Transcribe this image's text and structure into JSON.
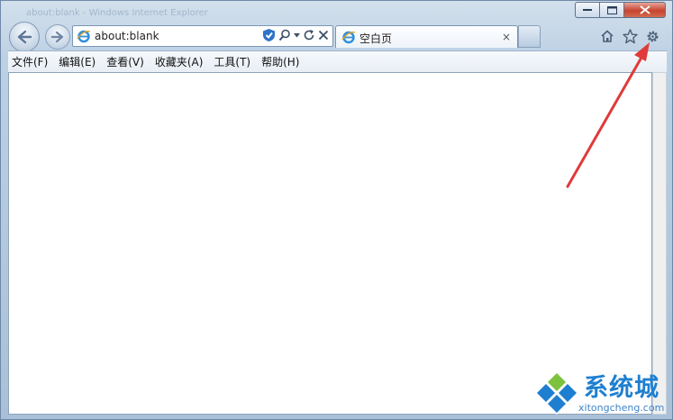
{
  "window": {
    "title_faint": "about:blank - Windows Internet Explorer",
    "minimize_glyph": "—",
    "maximize_glyph": "□",
    "close_glyph": "✕"
  },
  "address_bar": {
    "url": "about:blank",
    "icons": [
      "ie-icon",
      "shield-icon",
      "search-icon",
      "dropdown-icon",
      "refresh-icon",
      "stop-icon"
    ]
  },
  "tab": {
    "label": "空白页",
    "close_glyph": "×"
  },
  "toolbar_icons": [
    "home-icon",
    "star-icon",
    "gear-icon"
  ],
  "menu": {
    "items": [
      {
        "label": "文件(F)"
      },
      {
        "label": "编辑(E)"
      },
      {
        "label": "查看(V)"
      },
      {
        "label": "收藏夹(A)"
      },
      {
        "label": "工具(T)"
      },
      {
        "label": "帮助(H)"
      }
    ]
  },
  "watermark": {
    "brand": "系统城",
    "site": "xitongcheng.com"
  },
  "colors": {
    "annotation_arrow": "#e03a3a",
    "watermark_blue": "#1e7fd0"
  }
}
